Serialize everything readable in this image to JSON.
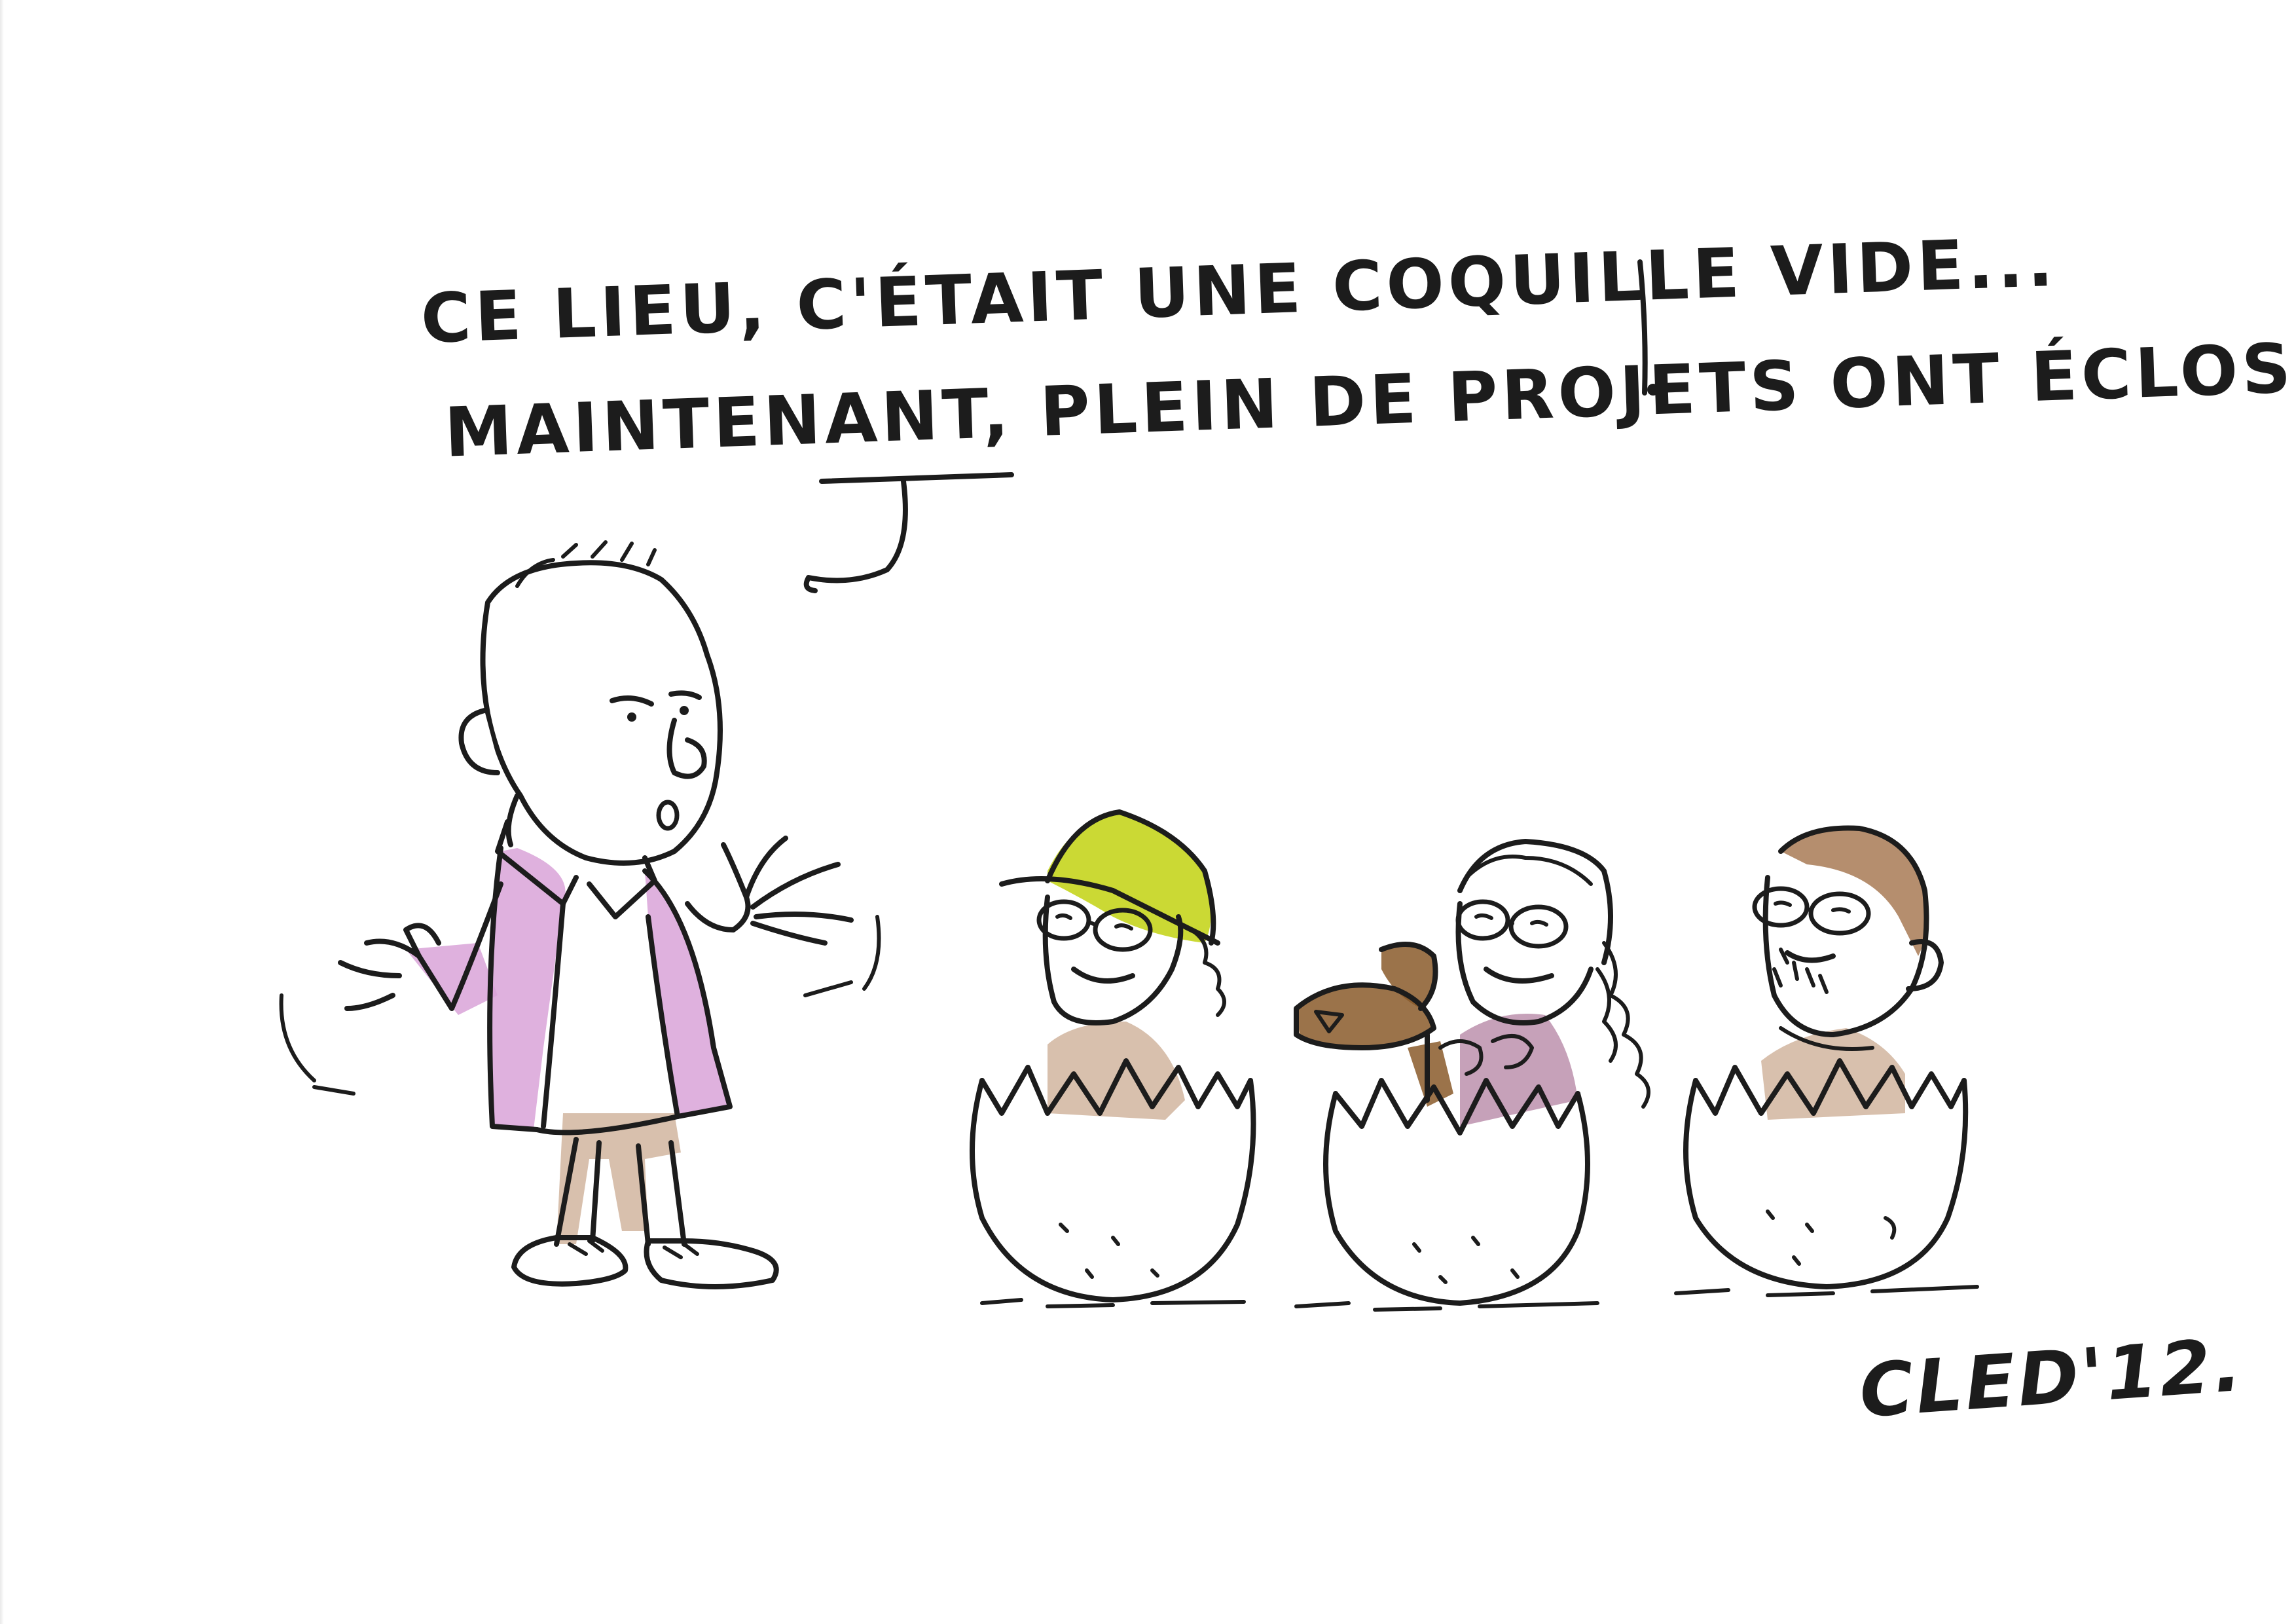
{
  "speech": {
    "line1": "Ce lieu, c'était une coquille vide...",
    "line2": "Maintenant, plein de projets ont éclos !"
  },
  "signature": "Cled'12.",
  "colors": {
    "paper": "#ffffff",
    "ink": "#1c1c1c",
    "jacket": "#d9a3d8",
    "cap": "#c5d51e",
    "skin": "#c8a58a",
    "brown": "#8a5a2a",
    "shirt": "#b88aa8",
    "hair": "#a87a55"
  },
  "figures": [
    {
      "name": "speaker",
      "description_icon": "man-in-pink-jacket-icon"
    },
    {
      "name": "egg-person-cap",
      "description_icon": "person-in-egg-with-cap-icon"
    },
    {
      "name": "egg-person-plant",
      "description_icon": "person-in-egg-with-sprout-icon"
    },
    {
      "name": "egg-person-bearded",
      "description_icon": "person-in-egg-bearded-icon"
    }
  ]
}
